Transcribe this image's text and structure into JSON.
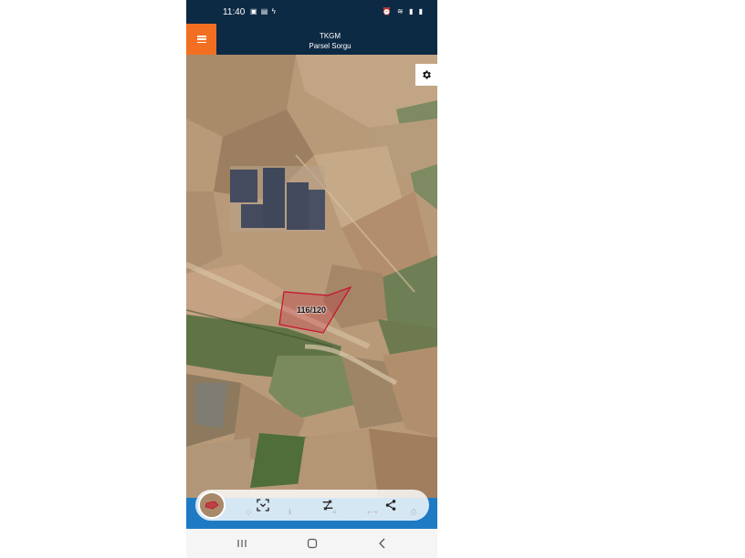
{
  "status": {
    "time": "11:40",
    "left_icons": [
      "gallery-icon",
      "photo-icon",
      "bolt-icon"
    ],
    "right_icons": [
      "alarm-icon",
      "wifi-icon",
      "signal-icon",
      "battery-icon"
    ]
  },
  "app": {
    "title_line1": "TKGM",
    "title_line2": "Parsel Sorgu"
  },
  "map": {
    "parcel_label": "116/120",
    "parcel_color": "#c8102e"
  },
  "toolbar": {
    "icons": [
      "scan-icon",
      "swap-icon",
      "share-icon"
    ]
  },
  "navbar": {
    "icons": [
      "recents-icon",
      "home-icon",
      "back-icon"
    ]
  },
  "colors": {
    "header": "#0d2a44",
    "menu_accent": "#f26f22",
    "toolbar_bar": "#1f7ac4"
  }
}
